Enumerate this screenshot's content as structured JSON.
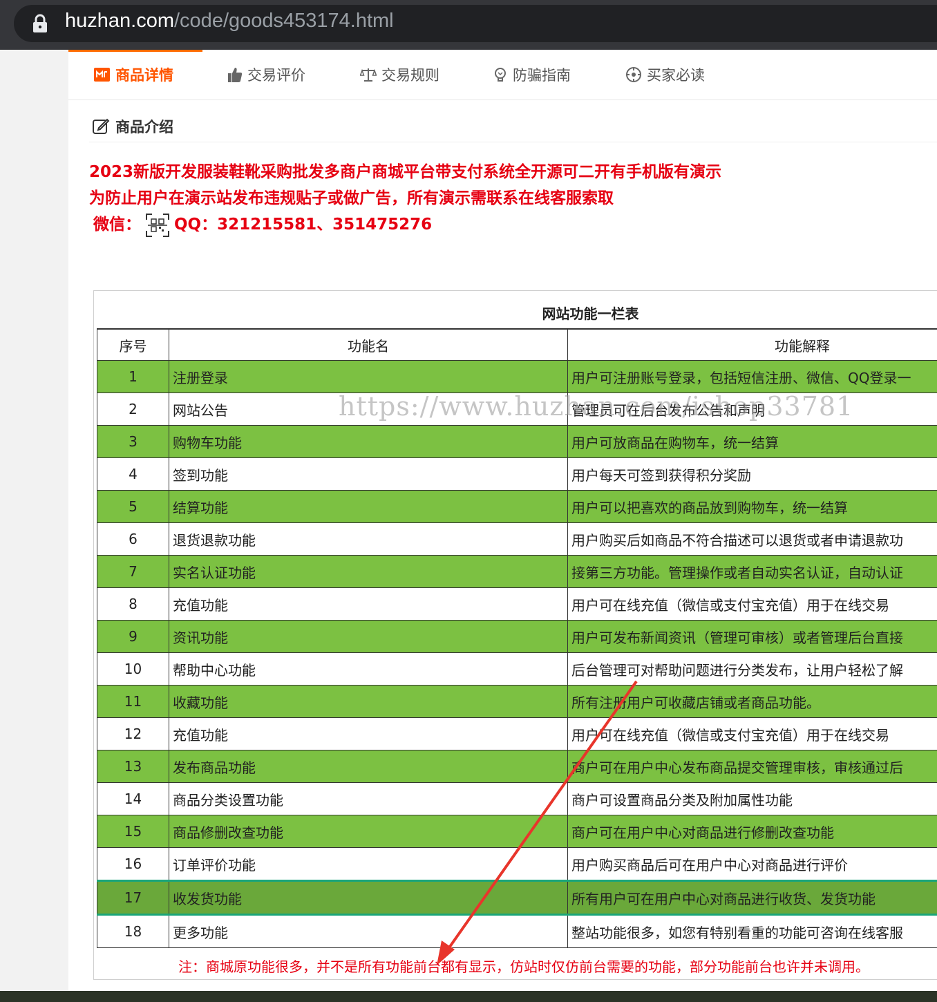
{
  "browser": {
    "url_domain": "huzhan.com",
    "url_path": "/code/goods453174.html"
  },
  "tabs": [
    {
      "label": "商品详情",
      "icon": "product-detail-icon",
      "active": true
    },
    {
      "label": "交易评价",
      "icon": "thumbs-up-icon",
      "active": false
    },
    {
      "label": "交易规则",
      "icon": "balance-scale-icon",
      "active": false
    },
    {
      "label": "防骗指南",
      "icon": "lightbulb-icon",
      "active": false
    },
    {
      "label": "买家必读",
      "icon": "target-icon",
      "active": false
    }
  ],
  "section": {
    "title": "商品介绍",
    "icon": "edit-icon"
  },
  "intro": {
    "line1": "2023新版开发服装鞋靴采购批发多商户商城平台带支付系统全开源可二开有手机版有演示",
    "line2": "为防止用户在演示站发布违规贴子或做广告，所有演示需联系在线客服索取",
    "wechat_label": "微信：",
    "qq_text": "QQ：321215581、351475276"
  },
  "feature_table": {
    "caption": "网站功能一栏表",
    "headers": [
      "序号",
      "功能名",
      "功能解释"
    ],
    "rows": [
      {
        "no": "1",
        "name": "注册登录",
        "desc": "用户可注册账号登录，包括短信注册、微信、QQ登录一"
      },
      {
        "no": "2",
        "name": "网站公告",
        "desc": "管理员可在后台发布公告和声明"
      },
      {
        "no": "3",
        "name": "购物车功能",
        "desc": "用户可放商品在购物车，统一结算"
      },
      {
        "no": "4",
        "name": "签到功能",
        "desc": "用户每天可签到获得积分奖励"
      },
      {
        "no": "5",
        "name": "结算功能",
        "desc": "用户可以把喜欢的商品放到购物车，统一结算"
      },
      {
        "no": "6",
        "name": "退货退款功能",
        "desc": "用户购买后如商品不符合描述可以退货或者申请退款功"
      },
      {
        "no": "7",
        "name": "实名认证功能",
        "desc": "接第三方功能。管理操作或者自动实名认证，自动认证"
      },
      {
        "no": "8",
        "name": "充值功能",
        "desc": "用户可在线充值（微信或支付宝充值）用于在线交易"
      },
      {
        "no": "9",
        "name": "资讯功能",
        "desc": "用户可发布新闻资讯（管理可审核）或者管理后台直接"
      },
      {
        "no": "10",
        "name": "帮助中心功能",
        "desc": "后台管理可对帮助问题进行分类发布，让用户轻松了解"
      },
      {
        "no": "11",
        "name": "收藏功能",
        "desc": "所有注册用户可收藏店铺或者商品功能。"
      },
      {
        "no": "12",
        "name": "充值功能",
        "desc": "用户可在线充值（微信或支付宝充值）用于在线交易"
      },
      {
        "no": "13",
        "name": "发布商品功能",
        "desc": "商户可在用户中心发布商品提交管理审核，审核通过后"
      },
      {
        "no": "14",
        "name": "商品分类设置功能",
        "desc": "商户可设置商品分类及附加属性功能"
      },
      {
        "no": "15",
        "name": "商品修删改查功能",
        "desc": "商户可在用户中心对商品进行修删改查功能"
      },
      {
        "no": "16",
        "name": "订单评价功能",
        "desc": "用户购买商品后可在用户中心对商品进行评价"
      },
      {
        "no": "17",
        "name": "收发货功能",
        "desc": "所有用户可在用户中心对商品进行收货、发货功能"
      },
      {
        "no": "18",
        "name": "更多功能",
        "desc": "整站功能很多，如您有特别看重的功能可咨询在线客服"
      }
    ],
    "note": "注：商城原功能很多，并不是所有功能前台都有显示，仿站时仅仿前台需要的功能，部分功能前台也许并未调用。",
    "watermark": "https://www.huzhan.com/ishop33781"
  },
  "colors": {
    "accent": "#ff5500",
    "intro_red": "#e60012",
    "row_green": "#7cc142",
    "arrow_red": "#e8352b"
  }
}
